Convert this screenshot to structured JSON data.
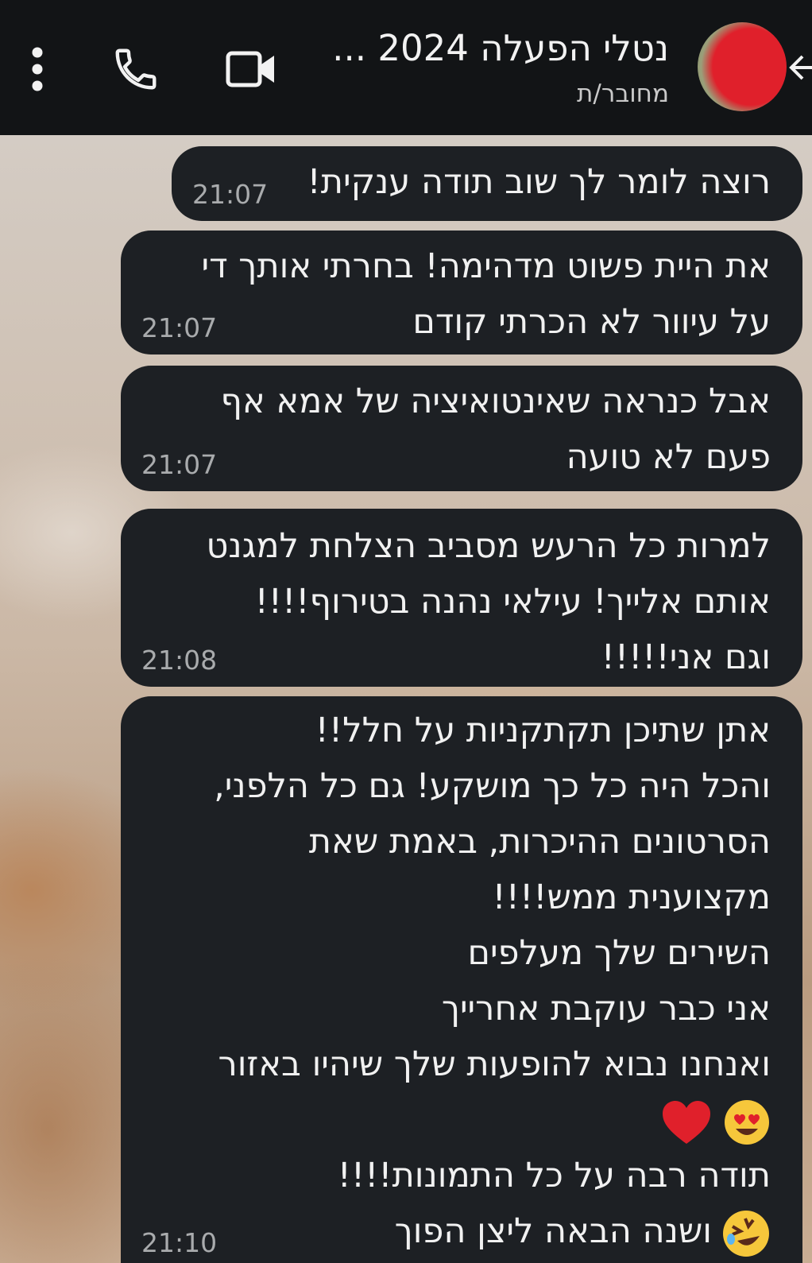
{
  "header": {
    "title": "נטלי הפעלה 2024 ...",
    "status": "מחובר/ת",
    "icons": [
      "back-arrow-icon",
      "avatar",
      "video-call-icon",
      "phone-icon",
      "more-vert-icon"
    ]
  },
  "messages": [
    {
      "text": "רוצה לומר לך שוב תודה ענקית!",
      "time": "21:07"
    },
    {
      "text": "את היית פשוט מדהימה! בחרתי אותך די\nעל עיוור לא הכרתי קודם",
      "time": "21:07"
    },
    {
      "text": "אבל כנראה שאינטואיציה של אמא אף\nפעם לא טועה",
      "time": "21:07"
    },
    {
      "text": "למרות כל הרעש מסביב הצלחת למגנט\nאותם אלייך! עילאי נהנה בטירוף!!!!\nוגם אני!!!!!",
      "time": "21:08"
    },
    {
      "lines": [
        "אתן שתיכן תקתקניות על חלל!!",
        "והכל היה כל כך מושקע! גם כל הלפני,",
        "הסרטונים ההיכרות, באמת שאת",
        "מקצוענית ממש!!!!",
        "השירים שלך מעלפים",
        "אני כבר עוקבת אחרייך",
        "ואנחנו נבוא להופעות שלך שיהיו באזור",
        "",
        "תודה רבה על כל התמונות!!!!",
        "ושנה הבאה ליצן הפוך"
      ],
      "emojis": [
        "heart-eyes-emoji",
        "red-heart-emoji",
        "rolling-laughing-emoji"
      ],
      "time": "21:10"
    }
  ],
  "colors": {
    "header_bg": "#121416",
    "bubble_bg": "#1d2024",
    "text": "#f1f1f1",
    "timestamp": "#a9abad"
  }
}
